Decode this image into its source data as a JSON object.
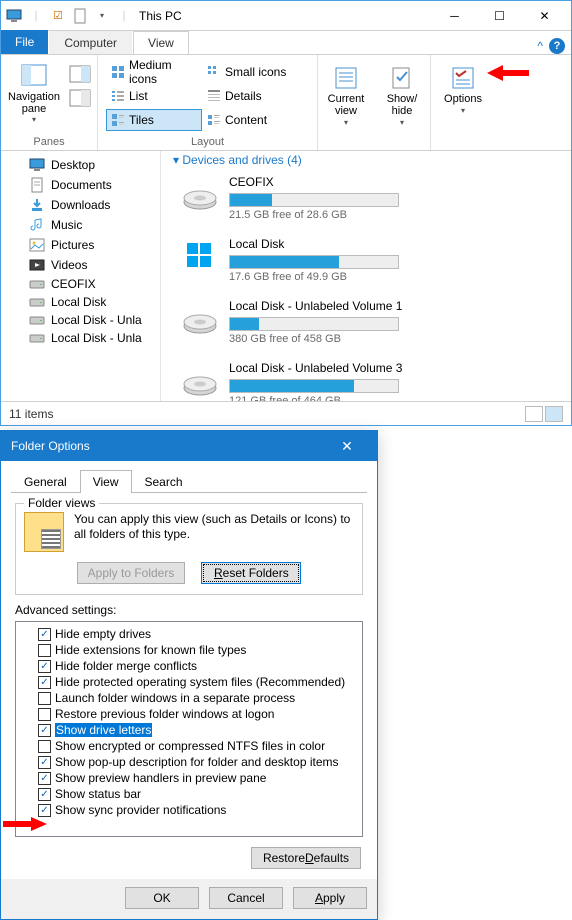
{
  "window": {
    "title": "This PC",
    "tabs": {
      "file": "File",
      "computer": "Computer",
      "view": "View"
    }
  },
  "ribbon": {
    "panes_label": "Panes",
    "navpane": "Navigation pane",
    "layout_label": "Layout",
    "layout": {
      "medium": "Medium icons",
      "small": "Small icons",
      "list": "List",
      "details": "Details",
      "tiles": "Tiles",
      "content": "Content"
    },
    "current_view": "Current view",
    "show_hide": "Show/ hide",
    "options": "Options"
  },
  "tree": [
    "Desktop",
    "Documents",
    "Downloads",
    "Music",
    "Pictures",
    "Videos",
    "CEOFIX",
    "Local Disk",
    "Local Disk - Unla",
    "Local Disk - Unla"
  ],
  "section": "Devices and drives (4)",
  "drives": [
    {
      "name": "CEOFIX",
      "free": "21.5 GB free of 28.6 GB",
      "fill": 25
    },
    {
      "name": "Local Disk",
      "free": "17.6 GB free of 49.9 GB",
      "fill": 65
    },
    {
      "name": "Local Disk - Unlabeled Volume 1",
      "free": "380 GB free of 458 GB",
      "fill": 17
    },
    {
      "name": "Local Disk - Unlabeled Volume 3",
      "free": "121 GB free of 464 GB",
      "fill": 74
    }
  ],
  "status": "11 items",
  "dialog": {
    "title": "Folder Options",
    "tabs": {
      "general": "General",
      "view": "View",
      "search": "Search"
    },
    "folder_views": "Folder views",
    "fv_text": "You can apply this view (such as Details or Icons) to all folders of this type.",
    "apply_folders": "Apply to Folders",
    "reset_folders": "Reset Folders",
    "adv_label": "Advanced settings:",
    "adv": [
      {
        "c": true,
        "t": "Hide empty drives"
      },
      {
        "c": false,
        "t": "Hide extensions for known file types"
      },
      {
        "c": true,
        "t": "Hide folder merge conflicts"
      },
      {
        "c": true,
        "t": "Hide protected operating system files (Recommended)"
      },
      {
        "c": false,
        "t": "Launch folder windows in a separate process"
      },
      {
        "c": false,
        "t": "Restore previous folder windows at logon"
      },
      {
        "c": true,
        "t": "Show drive letters",
        "sel": true
      },
      {
        "c": false,
        "t": "Show encrypted or compressed NTFS files in color"
      },
      {
        "c": true,
        "t": "Show pop-up description for folder and desktop items"
      },
      {
        "c": true,
        "t": "Show preview handlers in preview pane"
      },
      {
        "c": true,
        "t": "Show status bar"
      },
      {
        "c": true,
        "t": "Show sync provider notifications"
      }
    ],
    "restore": "Restore Defaults",
    "ok": "OK",
    "cancel": "Cancel",
    "apply": "Apply"
  }
}
